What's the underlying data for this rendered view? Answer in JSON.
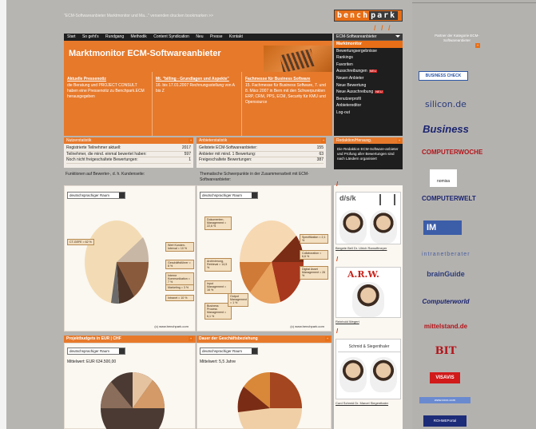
{
  "top_links": "\"ECM-Softwareanbieter Marktmonitor und Ma...\" versenden   drucken   bookmarken >>",
  "logo": {
    "left": "bench",
    "right": "park"
  },
  "nav": [
    "Start",
    "So geht's",
    "Rundgang",
    "Methodik",
    "Content Syndication",
    "Neu",
    "Presse",
    "Kontakt"
  ],
  "hero_title": "Marktmonitor ECM-Softwareanbieter",
  "news": [
    {
      "title": "Aktuelle Pressenotiz",
      "body": "die Beratung und PROJECT CONSULT haben eine Pressenotiz zu Benchpark.ECM herausgegeben"
    },
    {
      "title": "Mt. \"billing - Grundlagen und Aspekte\"",
      "body": "16. bis 17.01.2007 Rechnungsstellung von A bis Z"
    },
    {
      "title": "Fachmesse für Business Software",
      "body": "15. Fachmesse für Business Software, 7. und 8. März 2007 in Bern mit den Schwerpunkten ERP, CRM, PPS, ECM, Security für KMU und Opensource"
    }
  ],
  "menu": {
    "header": "ECM-Softwareanbieter",
    "items": [
      {
        "label": "Marktmonitor",
        "active": true,
        "badge": ""
      },
      {
        "label": "Bewertungsergebnisse",
        "active": false,
        "badge": ""
      },
      {
        "label": "Rankings",
        "active": false,
        "badge": ""
      },
      {
        "label": "Favoriten",
        "active": false,
        "badge": ""
      },
      {
        "label": "Ausschreibungen",
        "active": false,
        "badge": "NEU"
      },
      {
        "label": "Neuen Anbieter",
        "active": false,
        "badge": ""
      },
      {
        "label": "Neue Bewertung",
        "active": false,
        "badge": ""
      },
      {
        "label": "Neue Ausschreibung",
        "active": false,
        "badge": "NEU"
      },
      {
        "label": "Benutzerprofil",
        "active": false,
        "badge": ""
      },
      {
        "label": "Anbietereditor",
        "active": false,
        "badge": ""
      },
      {
        "label": "Log-out",
        "active": false,
        "badge": ""
      }
    ]
  },
  "nutzer": {
    "title": "Nutzerstatistik",
    "rows": [
      {
        "label": "Registrierte Teilnehmer aktuell:",
        "value": "2017"
      },
      {
        "label": "Teilnehmer, die mind. einmal bewertet haben:",
        "value": "597"
      },
      {
        "label": "Noch nicht freigeschaltete Bewertungen:",
        "value": "1"
      }
    ]
  },
  "anbieter": {
    "title": "Anbieterstatistik",
    "rows": [
      {
        "label": "Gelistete ECM-Softwareanbieter:",
        "value": "155"
      },
      {
        "label": "Anbieter mit mind. 1 Bewertung:",
        "value": "63"
      },
      {
        "label": "Freigeschaltete Bewertungen:",
        "value": "387"
      }
    ]
  },
  "redaktion": {
    "title": "Redaktion/Herausg.",
    "text": "Die Redaktion ECM-Software-anbieter und Prüfung aller Bewertungen sind nach Ländern organisiert"
  },
  "caption_left": "Funktionen auf Bewerter-, d. h. Kundenseite:",
  "caption_right": "Thematische Schwerpunkte in der Zusammenarbeit mit ECM-Softwareanbieter:",
  "select_label": "deutschsprachiger Raum",
  "panel_footer": "(c) www.benchpark.com",
  "chart_left": {
    "labels": [
      "CT-GEFE = 62 %",
      "Wert Kunden-Interval = 10 %",
      "Geschäftsführer = 8 %",
      "Interne Kommunikation = 7 %",
      "Marketing = 3 %",
      "Intranet = 10 %"
    ]
  },
  "chart_right": {
    "labels": [
      "Dokumenten-Management = 22,6 %",
      "Archivierung, Retrieval = 14,5 %",
      "Input Management = 16 %",
      "Business Process Management = 6,1 %",
      "Output Management = 1 %",
      "Spezifikation = 2,1 %",
      "Digital Asset Management = 26 %",
      "Collaboration = 6,6 %"
    ]
  },
  "bottom_left": {
    "title": "Projektbudgets in EUR | CHF",
    "mean": "Mittelwert: EUR 634.500,00"
  },
  "bottom_right": {
    "title": "Dauer der Geschäftsbeziehung",
    "mean": "Mittelwert: 5,5 Jahre"
  },
  "people": [
    {
      "company": "d/s/k",
      "names": "Bergete Bell Dr. Ulrich Ramoffmeyer"
    },
    {
      "company": "A.R.W.",
      "names": "Reinhold Wegert"
    },
    {
      "company": "Schmid & Siegenthaler",
      "names": "Curd Schmid Dr. Marcel Siegenthaler"
    }
  ],
  "partner_head": "Partner der Kategorie ECM-Softwareanbieter",
  "partners": [
    "BUSINESS CHECK",
    "silicon.de",
    "Business",
    "COMPUTERWOCHE",
    "nomisa",
    "COMPUTERWELT",
    "IM",
    "intranetberater",
    "brainGuide",
    "Computerworld",
    "mittelstand.de",
    "BIT",
    "VISAVIS",
    "www.xxxx.com",
    "ROHMEPortal"
  ]
}
